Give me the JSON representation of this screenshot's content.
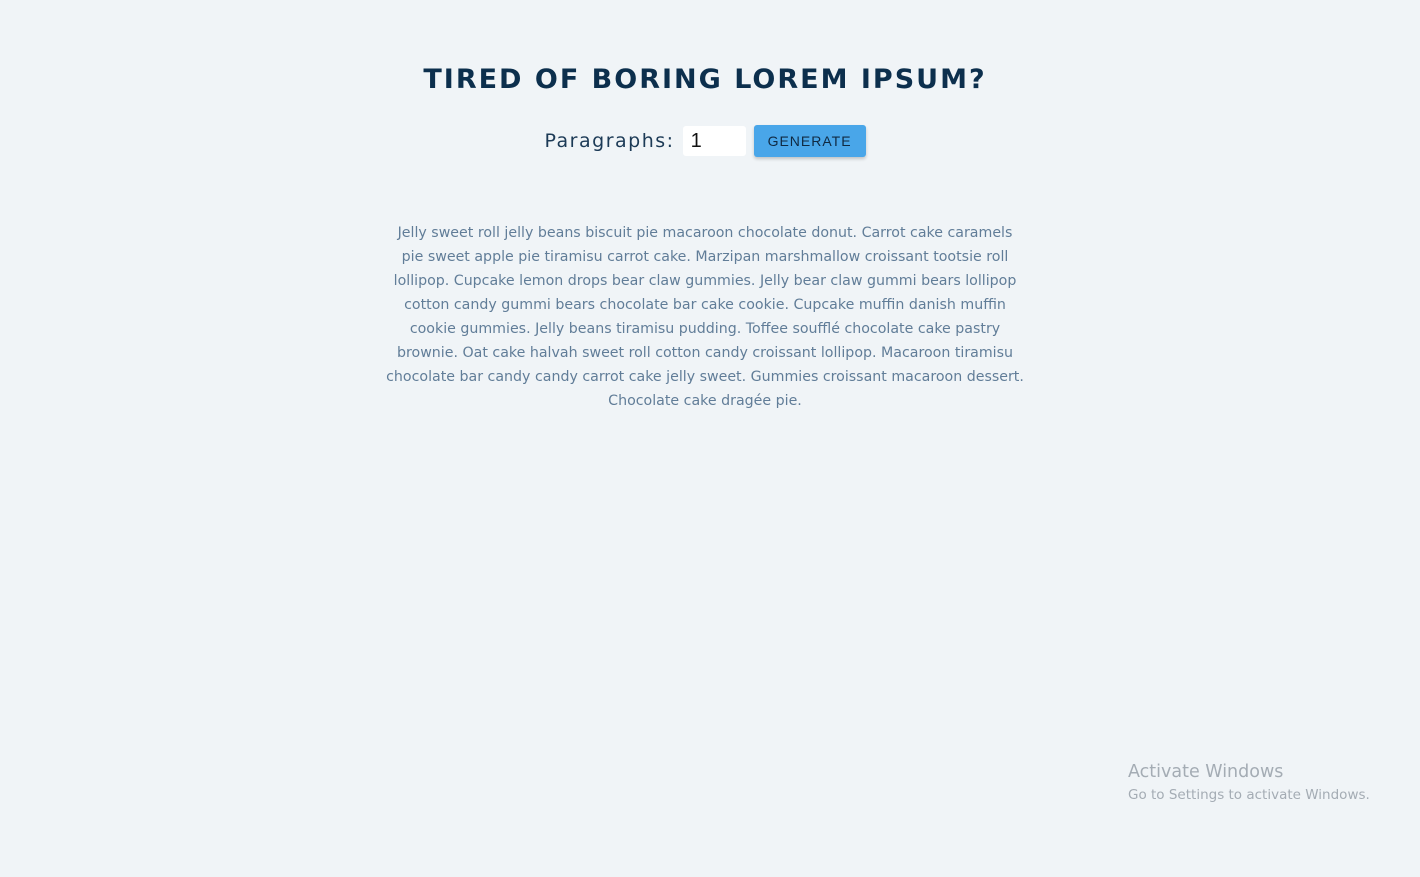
{
  "header": {
    "title": "TIRED OF BORING LOREM IPSUM?"
  },
  "form": {
    "amount_label": "Paragraphs:",
    "amount_value": "1",
    "generate_label": "GENERATE"
  },
  "result": {
    "paragraphs": [
      "Jelly sweet roll jelly beans biscuit pie macaroon chocolate donut. Carrot cake caramels pie sweet apple pie tiramisu carrot cake. Marzipan marshmallow croissant tootsie roll lollipop. Cupcake lemon drops bear claw gummies. Jelly bear claw gummi bears lollipop cotton candy gummi bears chocolate bar cake cookie. Cupcake muffin danish muffin cookie gummies. Jelly beans tiramisu pudding. Toffee soufflé chocolate cake pastry brownie. Oat cake halvah sweet roll cotton candy croissant lollipop. Macaroon tiramisu chocolate bar candy candy carrot cake jelly sweet. Gummies croissant macaroon dessert. Chocolate cake dragée pie."
    ]
  },
  "watermark": {
    "title": "Activate Windows",
    "subtitle": "Go to Settings to activate Windows."
  },
  "colors": {
    "background": "#f0f4f7",
    "title": "#0c2f4d",
    "button": "#49a6e9",
    "text": "#617d98"
  }
}
